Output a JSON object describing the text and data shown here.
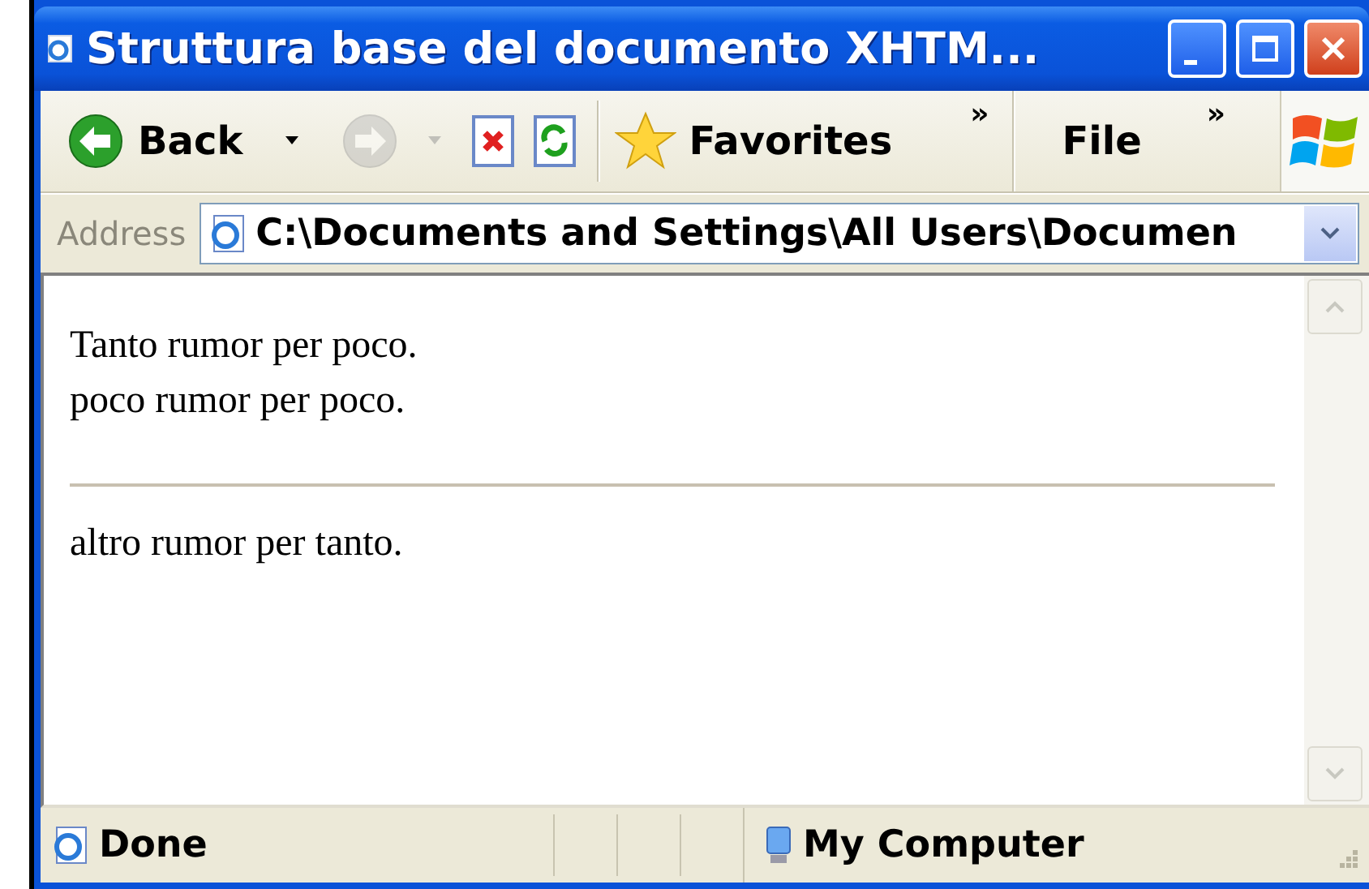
{
  "window": {
    "title": "Struttura base del documento XHTM..."
  },
  "toolbar": {
    "back": {
      "label": "Back",
      "disabled": false
    },
    "forward": {
      "disabled": true
    },
    "favorites": {
      "label": "Favorites"
    },
    "chevron": "»",
    "menu": [
      "File"
    ],
    "menu_chevron": "»"
  },
  "address_bar": {
    "label": "Address",
    "value": "C:\\Documents and Settings\\All Users\\Documen"
  },
  "content": [
    {
      "kind": "paragraph",
      "lines": [
        "Tanto rumor per poco.",
        "poco rumor per poco."
      ]
    },
    {
      "kind": "rule"
    },
    {
      "kind": "paragraph",
      "lines": [
        "altro rumor per tanto."
      ]
    }
  ],
  "status_bar": {
    "status": "Done",
    "zone": "My Computer"
  }
}
